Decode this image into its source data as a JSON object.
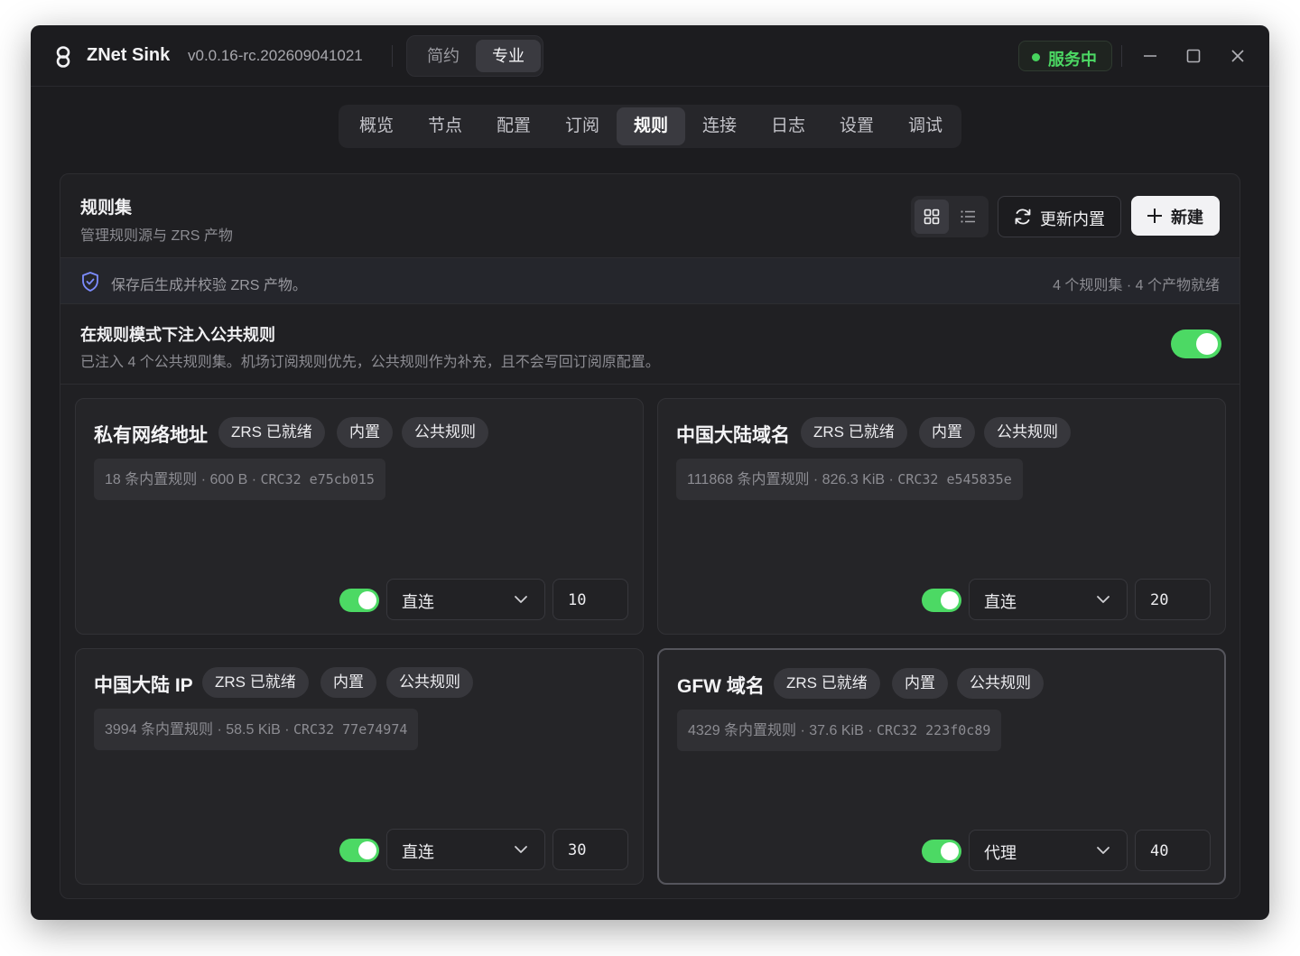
{
  "app": {
    "name": "ZNet Sink",
    "version": "v0.0.16-rc.202609041021",
    "modes": [
      "简约",
      "专业"
    ],
    "status": "服务中",
    "colors": {
      "accent_green": "#4cd964",
      "background": "#1c1c1f"
    }
  },
  "tabs": [
    "概览",
    "节点",
    "配置",
    "订阅",
    "规则",
    "连接",
    "日志",
    "设置",
    "调试"
  ],
  "active_tab": "规则",
  "panel": {
    "title": "规则集",
    "subtitle": "管理规则源与 ZRS 产物",
    "update_label": "更新内置",
    "new_label": "新建",
    "info": "保存后生成并校验 ZRS 产物。",
    "stats": "4 个规则集 · 4 个产物就绪",
    "inject_title": "在规则模式下注入公共规则",
    "inject_desc": "已注入 4 个公共规则集。机场订阅规则优先，公共规则作为补充，且不会写回订阅原配置。",
    "inject_enabled": true
  },
  "rulesets": [
    {
      "title": "私有网络地址",
      "badges": [
        "ZRS 已就绪",
        "内置",
        "公共规则"
      ],
      "meta": "18 条内置规则 · 600 B · ",
      "crc": "CRC32 e75cb015",
      "enabled": true,
      "action": "直连",
      "priority": "10"
    },
    {
      "title": "中国大陆域名",
      "badges": [
        "ZRS 已就绪",
        "内置",
        "公共规则"
      ],
      "meta": "111868 条内置规则 · 826.3 KiB · ",
      "crc": "CRC32 e545835e",
      "enabled": true,
      "action": "直连",
      "priority": "20"
    },
    {
      "title": "中国大陆 IP",
      "badges": [
        "ZRS 已就绪",
        "内置",
        "公共规则"
      ],
      "meta": "3994 条内置规则 · 58.5 KiB · ",
      "crc": "CRC32 77e74974",
      "enabled": true,
      "action": "直连",
      "priority": "30"
    },
    {
      "title": "GFW 域名",
      "badges": [
        "ZRS 已就绪",
        "内置",
        "公共规则"
      ],
      "meta": "4329 条内置规则 · 37.6 KiB · ",
      "crc": "CRC32 223f0c89",
      "enabled": true,
      "action": "代理",
      "priority": "40"
    }
  ]
}
